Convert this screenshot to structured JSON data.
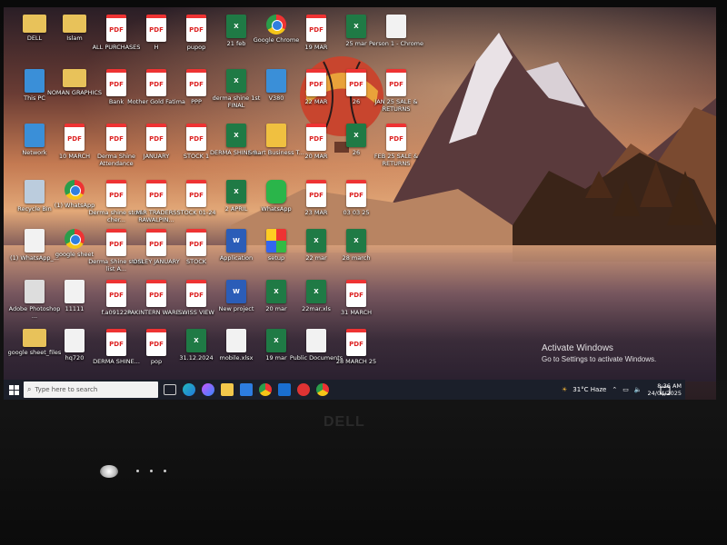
{
  "desktop": {
    "icons": [
      {
        "label": "DELL",
        "type": "folder"
      },
      {
        "label": "Islam",
        "type": "folder"
      },
      {
        "label": "ALL PURCHASES",
        "type": "pdf"
      },
      {
        "label": "H",
        "type": "pdf"
      },
      {
        "label": "pupop",
        "type": "pdf"
      },
      {
        "label": "21 feb",
        "type": "xls"
      },
      {
        "label": "Google Chrome",
        "type": "chrome"
      },
      {
        "label": "19 MAR",
        "type": "pdf"
      },
      {
        "label": "25 mar",
        "type": "xls"
      },
      {
        "label": "Person 1 - Chrome",
        "type": "file"
      },
      {
        "label": "This PC",
        "type": "sys"
      },
      {
        "label": "NOMAN GRAPHICS",
        "type": "folder"
      },
      {
        "label": "Bank",
        "type": "pdf"
      },
      {
        "label": "Mother Gold Fatima",
        "type": "pdf"
      },
      {
        "label": "PPP",
        "type": "pdf"
      },
      {
        "label": "derma shine 1st FINAL",
        "type": "xls"
      },
      {
        "label": "V380",
        "type": "sys"
      },
      {
        "label": "22 MAR",
        "type": "pdf"
      },
      {
        "label": "26",
        "type": "pdf"
      },
      {
        "label": "JAN 25 SALE & RETURNS",
        "type": "pdf"
      },
      {
        "label": "Network",
        "type": "sys"
      },
      {
        "label": "10 MARCH",
        "type": "pdf"
      },
      {
        "label": "Derma Shine Attendance",
        "type": "pdf"
      },
      {
        "label": "JANUARY",
        "type": "pdf"
      },
      {
        "label": "STOCK 1",
        "type": "pdf"
      },
      {
        "label": "DERMA SHINE S...",
        "type": "xls"
      },
      {
        "label": "Smart Business T...",
        "type": "app"
      },
      {
        "label": "20 MAR",
        "type": "pdf"
      },
      {
        "label": "26",
        "type": "xls"
      },
      {
        "label": "FEB 25 SALE & RETURNS",
        "type": "pdf"
      },
      {
        "label": "Recycle Bin",
        "type": "recycle"
      },
      {
        "label": "(1) WhatsApp",
        "type": "chrome"
      },
      {
        "label": "Derma shine stock cher...",
        "type": "pdf"
      },
      {
        "label": "M.R TRADERS RAWALPIN...",
        "type": "pdf"
      },
      {
        "label": "STOCK 01-24",
        "type": "pdf"
      },
      {
        "label": "2 APRIL",
        "type": "xls"
      },
      {
        "label": "WhatsApp",
        "type": "whats"
      },
      {
        "label": "23 MAR",
        "type": "pdf"
      },
      {
        "label": "03 03 25",
        "type": "pdf"
      },
      {
        "label": "(1) WhatsApp_...",
        "type": "file"
      },
      {
        "label": "google sheet",
        "type": "chrome"
      },
      {
        "label": "Derma Shine stock list A...",
        "type": "pdf"
      },
      {
        "label": "OSLEY JANUARY",
        "type": "pdf"
      },
      {
        "label": "STOCK",
        "type": "pdf"
      },
      {
        "label": "Application",
        "type": "doc"
      },
      {
        "label": "setup",
        "type": "setup"
      },
      {
        "label": "22 mar",
        "type": "xls"
      },
      {
        "label": "28 march",
        "type": "xls"
      },
      {
        "label": "Adobe Photoshop ...",
        "type": "ps"
      },
      {
        "label": "11111",
        "type": "file"
      },
      {
        "label": "f.a091224",
        "type": "pdf"
      },
      {
        "label": "PAKINTERN WARE...",
        "type": "pdf"
      },
      {
        "label": "SWISS VIEW",
        "type": "pdf"
      },
      {
        "label": "New project",
        "type": "doc"
      },
      {
        "label": "20 mar",
        "type": "xls"
      },
      {
        "label": "22mar.xls",
        "type": "xls"
      },
      {
        "label": "31 MARCH",
        "type": "pdf"
      },
      {
        "label": "google sheet_files",
        "type": "folder"
      },
      {
        "label": "hq720",
        "type": "file"
      },
      {
        "label": "DERMA SHINE...",
        "type": "pdf"
      },
      {
        "label": "pop",
        "type": "pdf"
      },
      {
        "label": "31.12.2024",
        "type": "xls"
      },
      {
        "label": "mobile.xlsx",
        "type": "file"
      },
      {
        "label": "19 mar",
        "type": "xls"
      },
      {
        "label": "Public Documents",
        "type": "file"
      },
      {
        "label": "28 MARCH 25",
        "type": "pdf"
      }
    ]
  },
  "watermark": {
    "title": "Activate Windows",
    "subtitle": "Go to Settings to activate Windows."
  },
  "taskbar": {
    "search_placeholder": "Type here to search",
    "weather": "31°C  Haze",
    "time": "8:36 AM",
    "date": "24/04/2025"
  },
  "bezel": {
    "brand": "DELL"
  },
  "colors": {
    "taskbar": "#1b1f2a",
    "pdf": "#e33333",
    "excel": "#1f7a45",
    "word": "#2b5db8"
  }
}
